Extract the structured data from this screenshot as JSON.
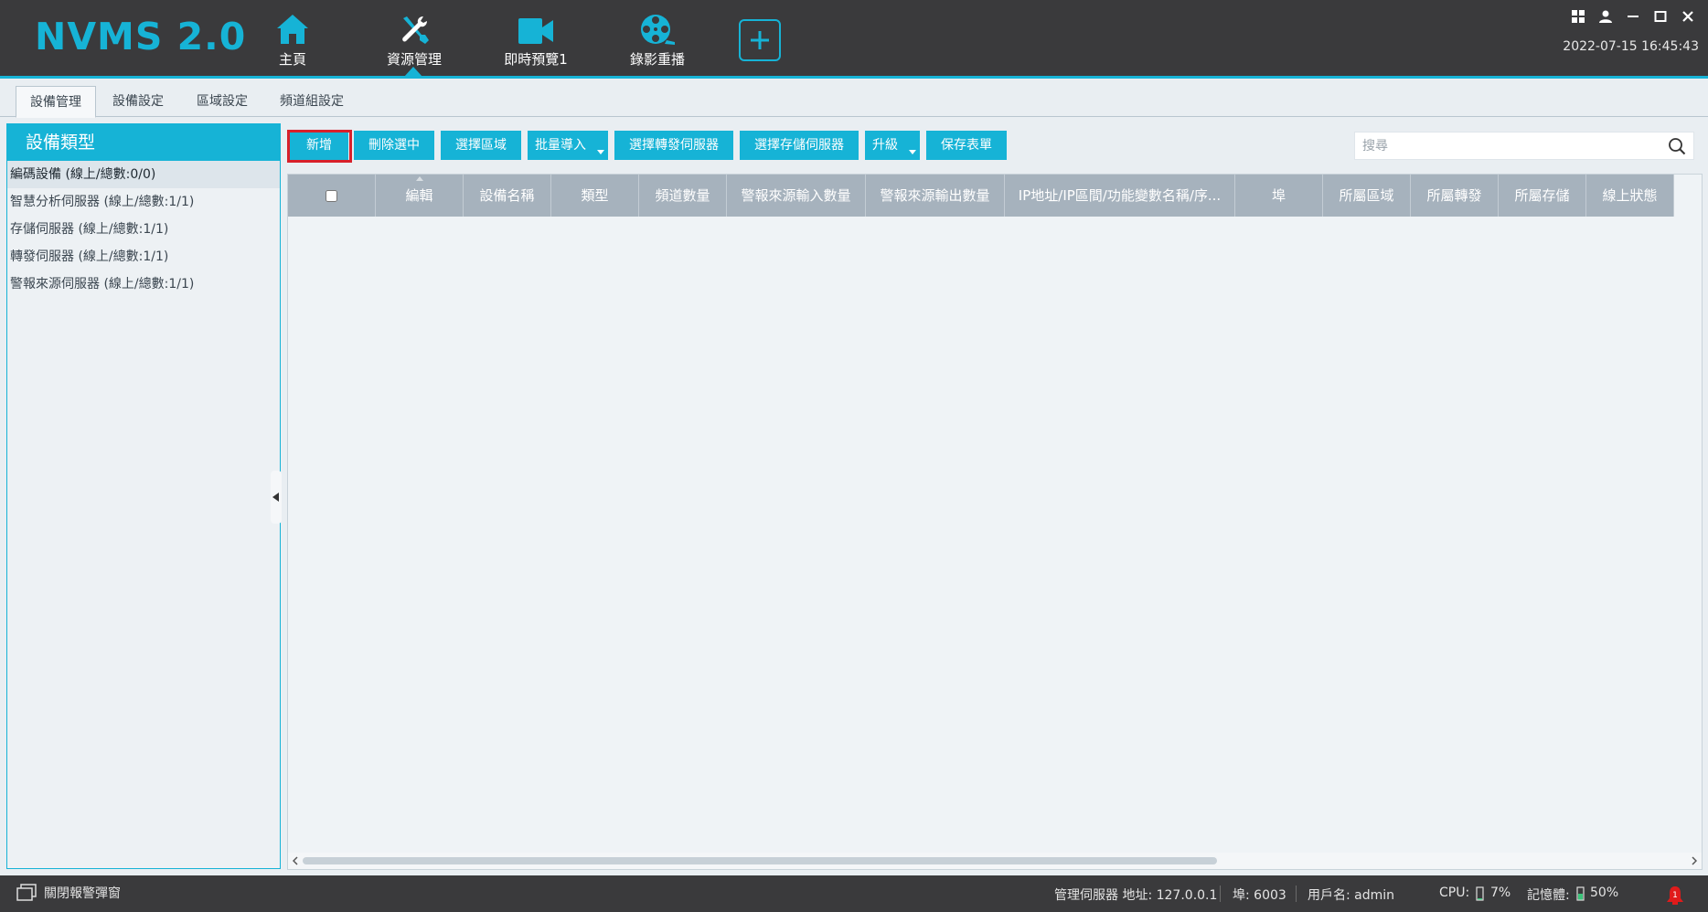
{
  "app": {
    "logo": "NVMS 2.0",
    "datetime": "2022-07-15 16:45:43"
  },
  "nav": [
    {
      "label": "主頁",
      "icon": "home-icon"
    },
    {
      "label": "資源管理",
      "icon": "tools-icon"
    },
    {
      "label": "即時預覽1",
      "icon": "video-camera-icon"
    },
    {
      "label": "錄影重播",
      "icon": "film-reel-icon"
    }
  ],
  "tabs": [
    "設備管理",
    "設備設定",
    "區域設定",
    "頻道組設定"
  ],
  "left_panel": {
    "title": "設備類型",
    "items": [
      "編碼設備 (線上/總數:0/0)",
      "智慧分析伺服器 (線上/總數:1/1)",
      "存儲伺服器 (線上/總數:1/1)",
      "轉發伺服器 (線上/總數:1/1)",
      "警報來源伺服器 (線上/總數:1/1)"
    ]
  },
  "toolbar": {
    "add": "新增",
    "delete_selected": "刪除選中",
    "select_area": "選擇區域",
    "batch_import": "批量導入",
    "select_forward_server": "選擇轉發伺服器",
    "select_storage_server": "選擇存儲伺服器",
    "upgrade": "升級",
    "save_form": "保存表單"
  },
  "search": {
    "placeholder": "搜尋"
  },
  "table": {
    "columns": [
      "編輯",
      "設備名稱",
      "類型",
      "頻道數量",
      "警報來源輸入數量",
      "警報來源輸出數量",
      "IP地址/IP區間/功能變數名稱/序...",
      "埠",
      "所屬區域",
      "所屬轉發",
      "所屬存儲",
      "線上狀態"
    ]
  },
  "statusbar": {
    "close_alarm_popup": "關閉報警彈窗",
    "server_address": "管理伺服器 地址: 127.0.0.1",
    "port": "埠: 6003",
    "username": "用戶名: admin",
    "cpu": "CPU:",
    "cpu_value": "7%",
    "memory": "記憶體:",
    "memory_value": "50%",
    "alarm_count": "1"
  },
  "colors": {
    "accent": "#16b3d6",
    "header_bg": "#3a3a3c",
    "highlight": "#d8202a"
  }
}
